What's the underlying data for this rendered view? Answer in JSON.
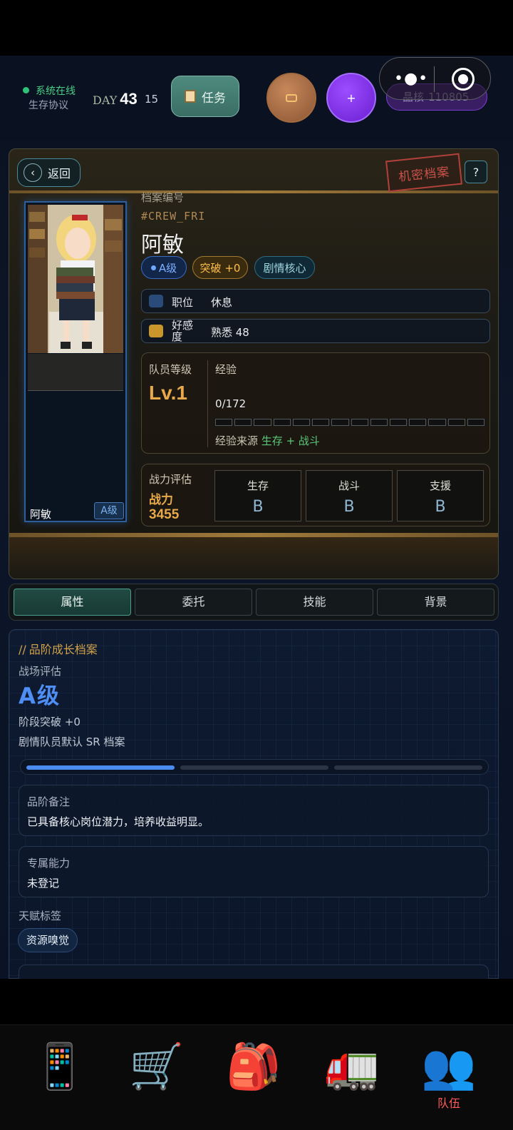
{
  "topbar": {
    "status_online": "系统在线",
    "status_sub": "生存协议",
    "day_label": "DAY",
    "day_value": "43",
    "day_sub": "15",
    "task_label": "任务",
    "radio_icon": "radio-icon",
    "plus_label": "+",
    "crystal_label": "晶核",
    "crystal_value": "110805",
    "colors": {
      "online": "#2fc37a",
      "task": "#4f8a7e",
      "plus": "#7a2fe0",
      "radio": "#a46a3f"
    }
  },
  "dossier": {
    "back_label": "返回",
    "stamp": "机密档案",
    "help": "?",
    "code_label": "档案编号",
    "code": "#CREW_FRI",
    "name": "阿敏",
    "tags": {
      "grade": "A级",
      "breakthrough": "突破 +0",
      "story": "剧情核心"
    },
    "role_label": "职位",
    "role_value": "休息",
    "favor_label": "好感度",
    "favor_value": "熟悉 48",
    "card": {
      "name": "阿敏",
      "grade": "A级"
    },
    "level": {
      "title": "队员等级",
      "value": "Lv.1",
      "exp_label": "经验",
      "exp_value": "0/172",
      "exp_progress": 0,
      "source_label": "经验来源",
      "source_value": "生存 + 战斗"
    },
    "power": {
      "title": "战力评估",
      "label": "战力",
      "value": "3455",
      "stats": [
        {
          "name": "生存",
          "grade": "B"
        },
        {
          "name": "战斗",
          "grade": "B"
        },
        {
          "name": "支援",
          "grade": "B"
        }
      ]
    }
  },
  "tabs": [
    "属性",
    "委托",
    "技能",
    "背景"
  ],
  "attributes": {
    "section_title": "品阶成长档案",
    "battle_label": "战场评估",
    "grade": "A级",
    "breakthrough": "阶段突破 +0",
    "default_note": "剧情队员默认 SR 档案",
    "grade_progress_steps": 3,
    "grade_progress_filled": 1,
    "note_label": "品阶备注",
    "note_value": "已具备核心岗位潜力，培养收益明显。",
    "ability_label": "专属能力",
    "ability_value": "未登记",
    "talent_label": "天赋标签",
    "talent_tag": "资源嗅觉"
  },
  "bottom_nav": [
    {
      "icon": "📱",
      "name": "phone"
    },
    {
      "icon": "🛒",
      "name": "shop"
    },
    {
      "icon": "🎒",
      "name": "backpack"
    },
    {
      "icon": "🚛",
      "name": "truck"
    },
    {
      "icon": "👥",
      "name": "team",
      "label": "队伍"
    }
  ]
}
